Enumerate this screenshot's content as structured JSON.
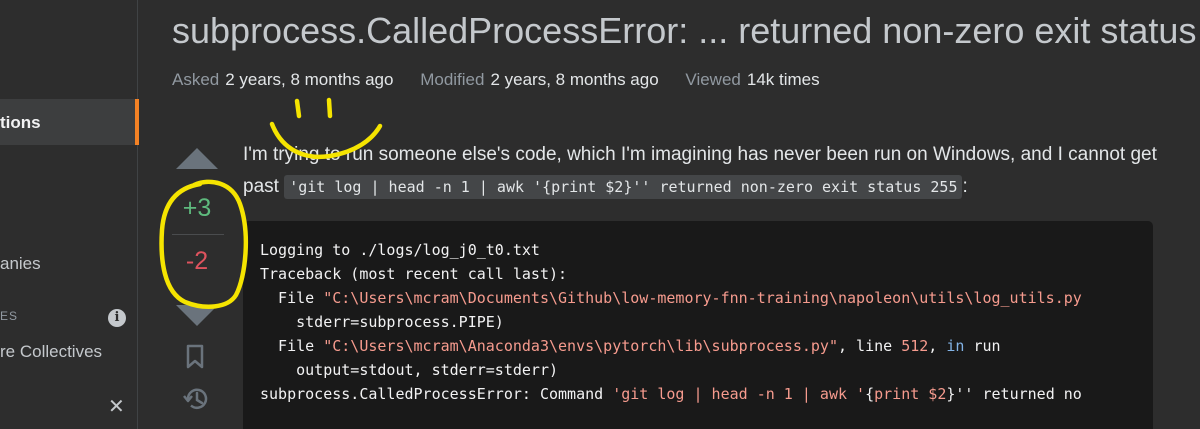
{
  "header": {
    "title": "subprocess.CalledProcessError: ... returned non-zero exit status",
    "meta": [
      {
        "key": "Asked",
        "value": "2 years, 8 months ago"
      },
      {
        "key": "Modified",
        "value": "2 years, 8 months ago"
      },
      {
        "key": "Viewed",
        "value": "14k times"
      }
    ]
  },
  "sidebar": {
    "active_item": "tions",
    "companies": "anies",
    "section_label": "ES",
    "collectives": "re Collectives",
    "info_icon": "i",
    "close_icon": "✕"
  },
  "votes": {
    "up": "+3",
    "down": "-2"
  },
  "question": {
    "text_before": "I'm trying to run someone else's code, which I'm imagining has never been run on Windows, and I cannot get past ",
    "inline_code": "'git log | head -n 1 | awk '{print $2}'' returned non-zero exit status 255",
    "text_after": ":"
  },
  "code": {
    "line1": "Logging to ./logs/log_j0_t0.txt",
    "line2": "Traceback (most recent call last):",
    "line3_prefix": "  File ",
    "line3_path": "\"C:\\Users\\mcram\\Documents\\Github\\low-memory-fnn-training\\napoleon\\utils\\log_utils.py",
    "line4": "    stderr=subprocess.PIPE)",
    "line5_prefix": "  File ",
    "line5_path": "\"C:\\Users\\mcram\\Anaconda3\\envs\\pytorch\\lib\\subprocess.py\"",
    "line5_mid": ", line ",
    "line5_num": "512",
    "line5_sep": ", ",
    "line5_kw": "in",
    "line5_end": " run",
    "line6": "    output=stdout, stderr=stderr)",
    "line7_prefix": "subprocess.CalledProcessError: Command ",
    "line7_cmd1": "'git log | head -n 1 | awk '",
    "line7_brace": "{",
    "line7_print": "print $2",
    "line7_end": "}'' returned no"
  },
  "colors": {
    "accent": "#f48225",
    "upvote": "#5eba7d",
    "downvote": "#de535e",
    "annotation": "#f5e400"
  },
  "icons": [
    "info-icon",
    "close-icon",
    "upvote-arrow-icon",
    "downvote-arrow-icon",
    "bookmark-icon",
    "history-icon"
  ]
}
